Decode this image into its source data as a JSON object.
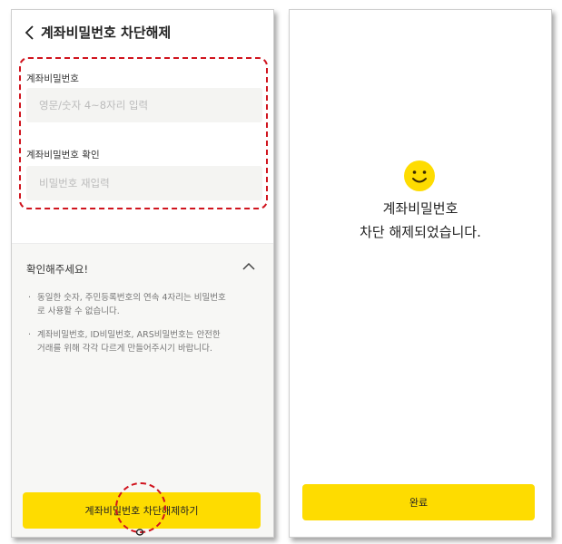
{
  "left": {
    "header": {
      "title": "계좌비밀번호 차단해제",
      "back_icon": "chevron-left-icon"
    },
    "form": {
      "password_label": "계좌비밀번호",
      "password_placeholder": "영문/숫자 4~8자리 입력",
      "confirm_label": "계좌비밀번호 확인",
      "confirm_placeholder": "비밀번호 재입력"
    },
    "notice": {
      "title": "확인해주세요!",
      "toggle_icon": "chevron-up-icon",
      "items": [
        {
          "line1": "동일한 숫자, 주민등록번호의 연속 4자리는 비밀번호",
          "line2": "로 사용할 수 없습니다."
        },
        {
          "line1": "계좌비밀번호, ID비밀번호, ARS비밀번호는 안전한",
          "line2": "거래를 위해 각각 다르게 만들어주시기 바랍니다."
        }
      ]
    },
    "button_label": "계좌비밀번호 차단해제하기",
    "colors": {
      "highlight": "#d0141e",
      "button": "#fedc00"
    }
  },
  "right": {
    "icon": "smile-icon",
    "message_line1": "계좌비밀번호",
    "message_line2": "차단 해제되었습니다.",
    "button_label": "완료"
  }
}
